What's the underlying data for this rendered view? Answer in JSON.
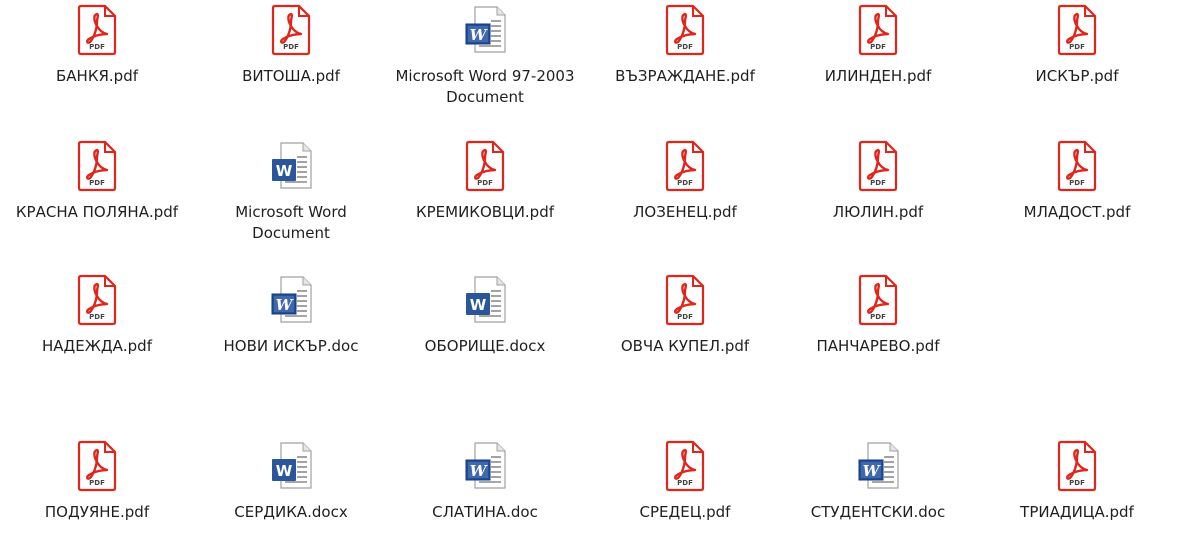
{
  "window": {
    "title": ""
  },
  "files": [
    {
      "name": "БАНКЯ.pdf",
      "icon": "pdf-icon",
      "label": "PDF"
    },
    {
      "name": "ВИТОША.pdf",
      "icon": "pdf-icon",
      "label": "PDF"
    },
    {
      "name": "Microsoft Word 97-2003 Document",
      "icon": "word-97-icon",
      "label": "W"
    },
    {
      "name": "ВЪЗРАЖДАНЕ.pdf",
      "icon": "pdf-icon",
      "label": "PDF"
    },
    {
      "name": "ИЛИНДЕН.pdf",
      "icon": "pdf-icon",
      "label": "PDF"
    },
    {
      "name": "ИСКЪР.pdf",
      "icon": "pdf-icon",
      "label": "PDF"
    },
    {
      "name": "КРАСНА ПОЛЯНА.pdf",
      "icon": "pdf-icon",
      "label": "PDF"
    },
    {
      "name": "Microsoft Word Document",
      "icon": "word-icon",
      "label": "W"
    },
    {
      "name": "КРЕМИКОВЦИ.pdf",
      "icon": "pdf-icon",
      "label": "PDF"
    },
    {
      "name": "ЛОЗЕНЕЦ.pdf",
      "icon": "pdf-icon",
      "label": "PDF"
    },
    {
      "name": "ЛЮЛИН.pdf",
      "icon": "pdf-icon",
      "label": "PDF"
    },
    {
      "name": "МЛАДОСТ.pdf",
      "icon": "pdf-icon",
      "label": "PDF"
    },
    {
      "name": "НАДЕЖДА.pdf",
      "icon": "pdf-icon",
      "label": "PDF"
    },
    {
      "name": "НОВИ ИСКЪР.doc",
      "icon": "word-97-icon",
      "label": "W"
    },
    {
      "name": "ОБОРИЩЕ.docx",
      "icon": "word-icon",
      "label": "W"
    },
    {
      "name": "ОВЧА КУПЕЛ.pdf",
      "icon": "pdf-icon",
      "label": "PDF"
    },
    {
      "name": "ПАНЧАРЕВО.pdf",
      "icon": "pdf-icon",
      "label": "PDF"
    },
    {
      "name": "ПОДУЯНЕ.pdf",
      "icon": "pdf-icon",
      "label": "PDF"
    },
    {
      "name": "СЕРДИКА.docx",
      "icon": "word-icon",
      "label": "W"
    },
    {
      "name": "СЛАТИНА.doc",
      "icon": "word-97-icon",
      "label": "W"
    },
    {
      "name": "СРЕДЕЦ.pdf",
      "icon": "pdf-icon",
      "label": "PDF"
    },
    {
      "name": "СТУДЕНТСКИ.doc",
      "icon": "word-97-icon",
      "label": "W"
    },
    {
      "name": "ТРИАДИЦА.pdf",
      "icon": "pdf-icon",
      "label": "PDF"
    }
  ],
  "colors": {
    "pdf_red": "#e1251b",
    "pdf_dark": "#b71c1c",
    "word_blue": "#2b579a",
    "word97_blue": "#1f4e9c",
    "paper": "#ffffff",
    "paper_border": "#a0a0a0",
    "text": "#1f1f1f"
  }
}
